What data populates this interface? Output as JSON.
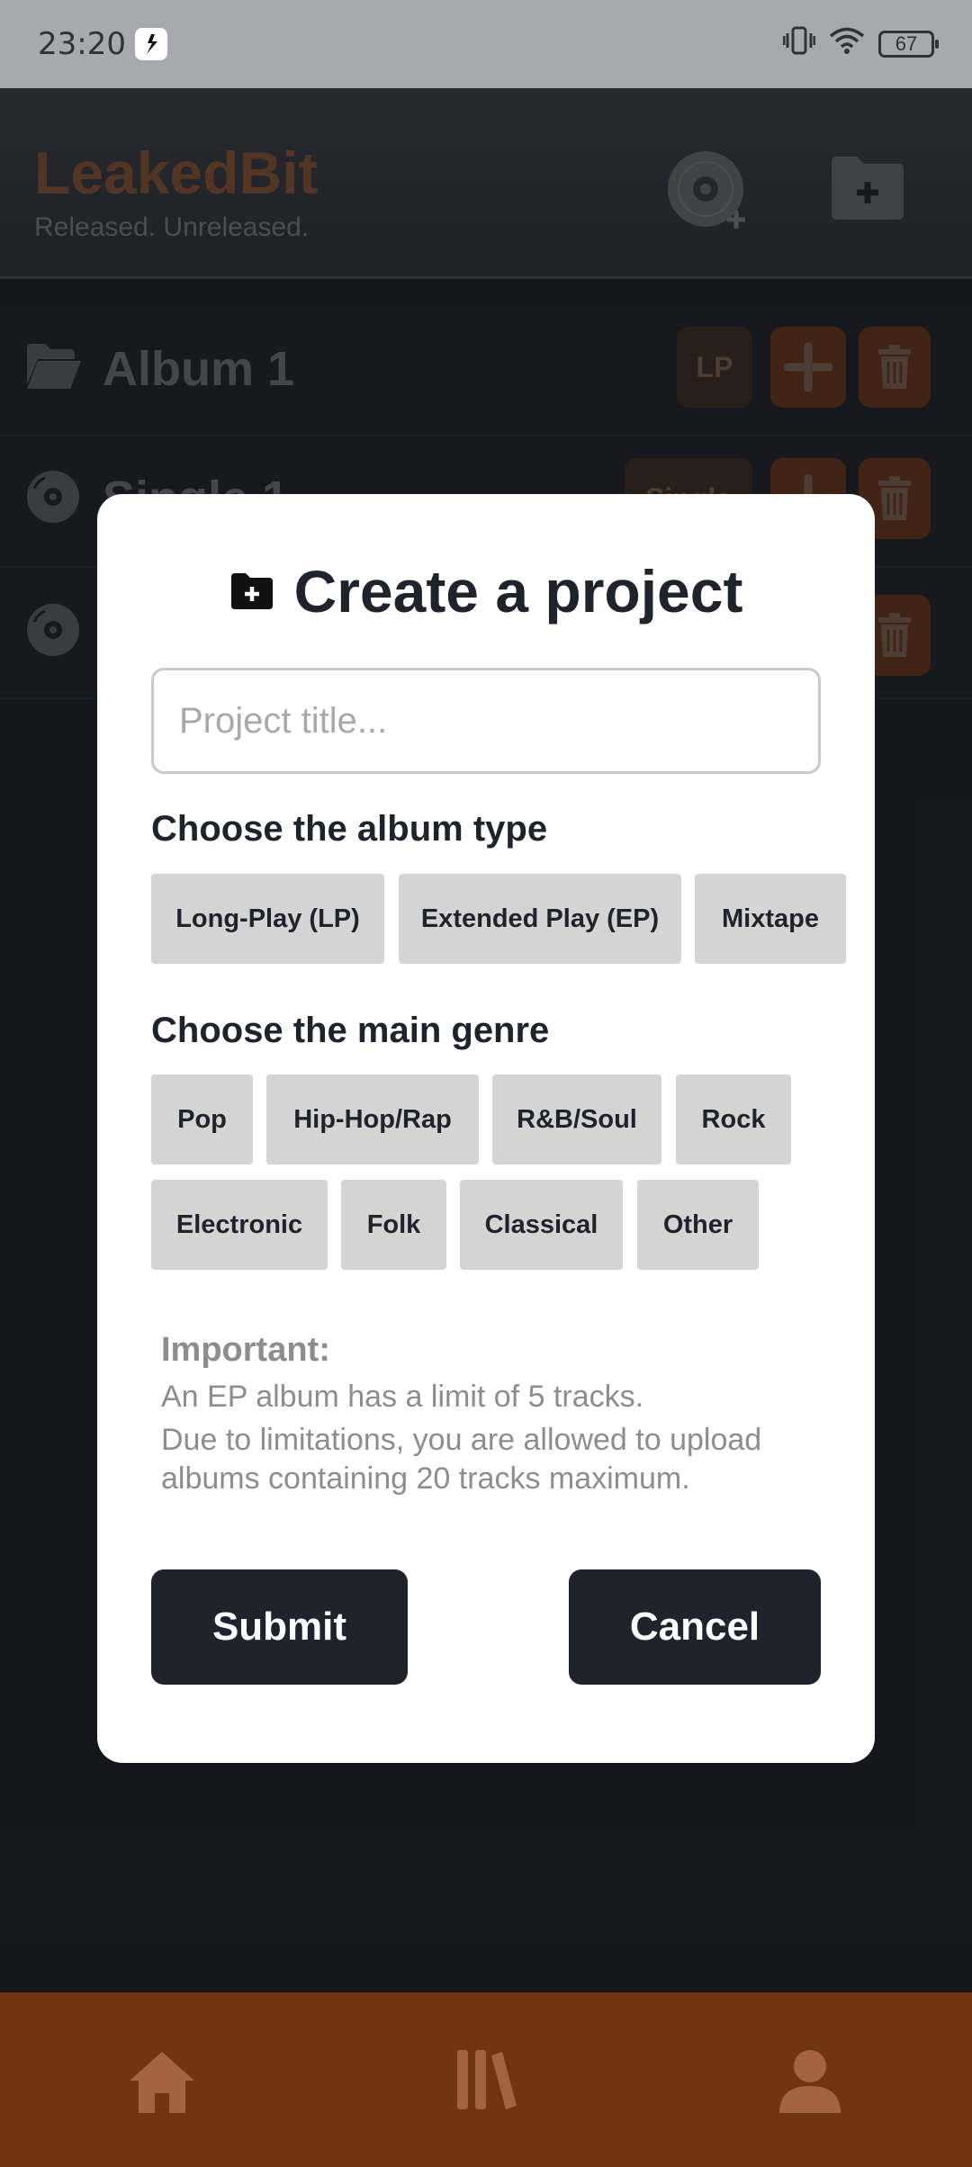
{
  "status_bar": {
    "time": "23:20",
    "battery": "67"
  },
  "header": {
    "app_name": "LeakedBit",
    "tagline": "Released. Unreleased."
  },
  "projects": [
    {
      "title": "Album 1",
      "type_label": "LP",
      "icon": "folder-open-icon"
    },
    {
      "title": "Single 1",
      "type_label": "Single",
      "icon": "disc-icon"
    },
    {
      "title": "",
      "type_label": "",
      "icon": "disc-icon"
    }
  ],
  "modal": {
    "title": "Create a project",
    "title_placeholder": "Project title...",
    "album_type_label": "Choose the album type",
    "album_types": [
      "Long-Play (LP)",
      "Extended Play (EP)",
      "Mixtape"
    ],
    "genre_label": "Choose the main genre",
    "genres": [
      "Pop",
      "Hip-Hop/Rap",
      "R&B/Soul",
      "Rock",
      "Electronic",
      "Folk",
      "Classical",
      "Other"
    ],
    "important_heading": "Important:",
    "important_lines": [
      "An EP album has a limit of 5 tracks.",
      "Due to limitations, you are allowed to upload albums containing 20 tracks maximum."
    ],
    "submit_label": "Submit",
    "cancel_label": "Cancel"
  },
  "nav": {
    "items": [
      "home-icon",
      "library-icon",
      "profile-icon"
    ]
  },
  "colors": {
    "brand": "#8a5233",
    "accent_brown": "#713513",
    "button_dark": "#1f232c"
  }
}
